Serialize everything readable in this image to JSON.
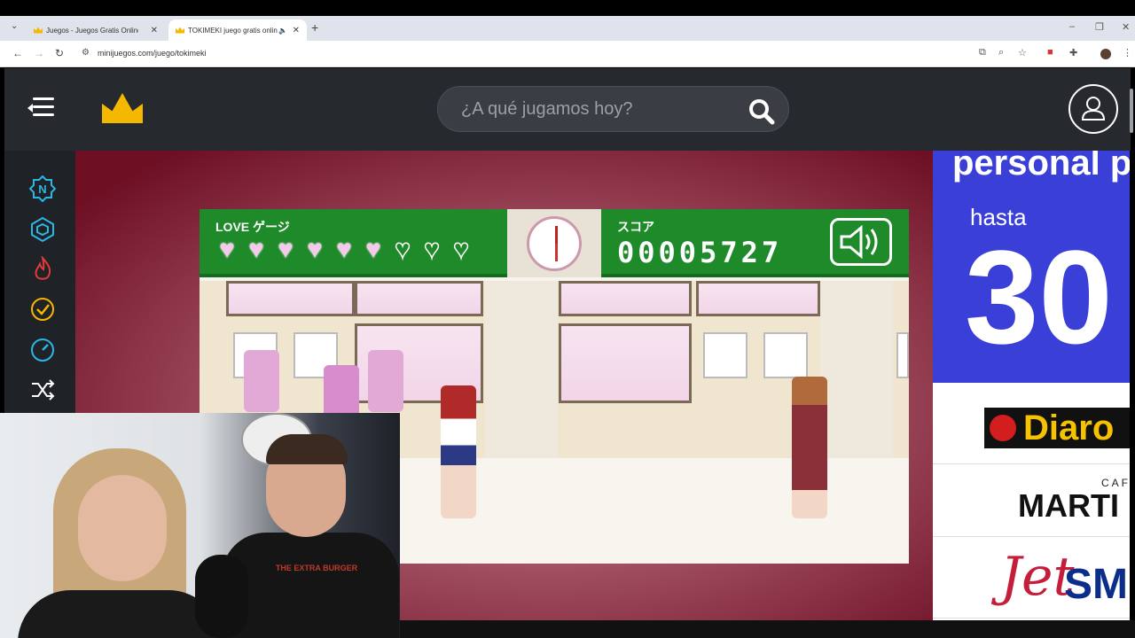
{
  "browser": {
    "tabs": [
      {
        "title": "Juegos - Juegos Gratis Online e",
        "active": false
      },
      {
        "title": "TOKIMEKI juego gratis onlin",
        "active": true
      }
    ],
    "url": "minijuegos.com/juego/tokimeki"
  },
  "site": {
    "search": {
      "placeholder": "¿A qué jugamos hoy?"
    },
    "sidebar_icons": [
      "new-icon",
      "cube-icon",
      "fire-icon",
      "check-badge-icon",
      "speedometer-icon",
      "shuffle-icon"
    ],
    "accent_color": "#f5b800",
    "sidebar_icon_color": "#2bb7e6"
  },
  "game": {
    "love_label": "LOVE ゲージ",
    "hearts": {
      "filled": 6,
      "total": 9
    },
    "score_label": "スコア",
    "score": "00005727"
  },
  "ad": {
    "line1": "personal p",
    "line2": "hasta",
    "line3": "30",
    "brand1": "Diaro",
    "brand2_small": "CAFE",
    "brand2_big": "MARTI",
    "brand3_jet": "Jet",
    "brand3_sm": "SM"
  },
  "webcam": {
    "shirt_text": "THE EXTRA BURGER"
  }
}
